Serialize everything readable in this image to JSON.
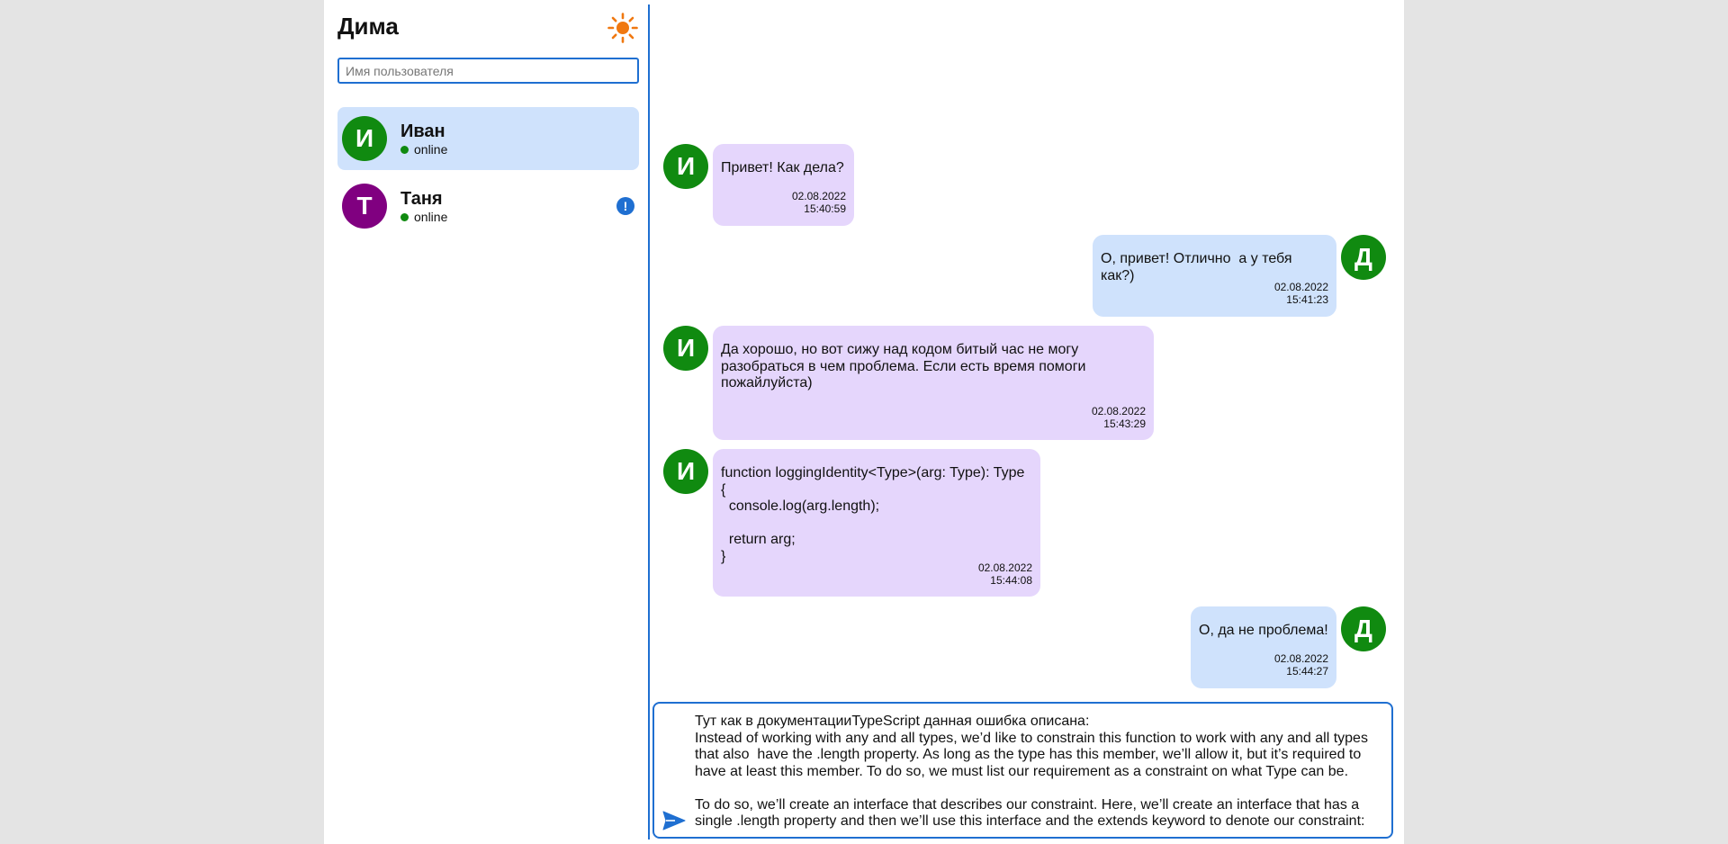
{
  "sidebar": {
    "current_user": "Дима",
    "theme_icon": "sun-icon",
    "search": {
      "placeholder": "Имя пользователя",
      "value": ""
    },
    "contacts": [
      {
        "initial": "И",
        "name": "Иван",
        "status": "online",
        "avatar_color": "#108a10",
        "active": true,
        "unread": false
      },
      {
        "initial": "Т",
        "name": "Таня",
        "status": "online",
        "avatar_color": "#800080",
        "active": false,
        "unread": true,
        "badge": "!"
      }
    ]
  },
  "messages": [
    {
      "direction": "in",
      "initial": "И",
      "text": "Привет! Как дела?",
      "date": "02.08.2022",
      "time": "15:40:59"
    },
    {
      "direction": "out",
      "initial": "Д",
      "text": "О, привет! Отлично  а у тебя как?)",
      "date": "02.08.2022",
      "time": "15:41:23"
    },
    {
      "direction": "in",
      "initial": "И",
      "text": "Да хорошо, но вот сижу над кодом битый час не могу разобраться в чем проблема. Если есть время помоги пожайлуйста)",
      "date": "02.08.2022",
      "time": "15:43:29"
    },
    {
      "direction": "in",
      "initial": "И",
      "text": "function loggingIdentity<Type>(arg: Type): Type {\n  console.log(arg.length);\n\n  return arg;\n}",
      "date": "02.08.2022",
      "time": "15:44:08"
    },
    {
      "direction": "out",
      "initial": "Д",
      "text": "О, да не проблема!",
      "date": "02.08.2022",
      "time": "15:44:27"
    }
  ],
  "composer": {
    "text": "Тут как в документацииTypeScript данная ошибка описана:\nInstead of working with any and all types, we’d like to constrain this function to work with any and all types that also  have the .length property. As long as the type has this member, we’ll allow it, but it’s required to have at least this member. To do so, we must list our requirement as a constraint on what Type can be.\n\nTo do so, we’ll create an interface that describes our constraint. Here, we’ll create an interface that has a single .length property and then we’ll use this interface and the extends keyword to denote our constraint:",
    "send_icon": "send-icon"
  },
  "colors": {
    "accent": "#1f6fd1",
    "incoming_bubble": "#e5d6fc",
    "outgoing_bubble": "#cfe2fc",
    "avatar_green": "#108a10",
    "avatar_purple": "#800080",
    "sun": "#f07810"
  }
}
